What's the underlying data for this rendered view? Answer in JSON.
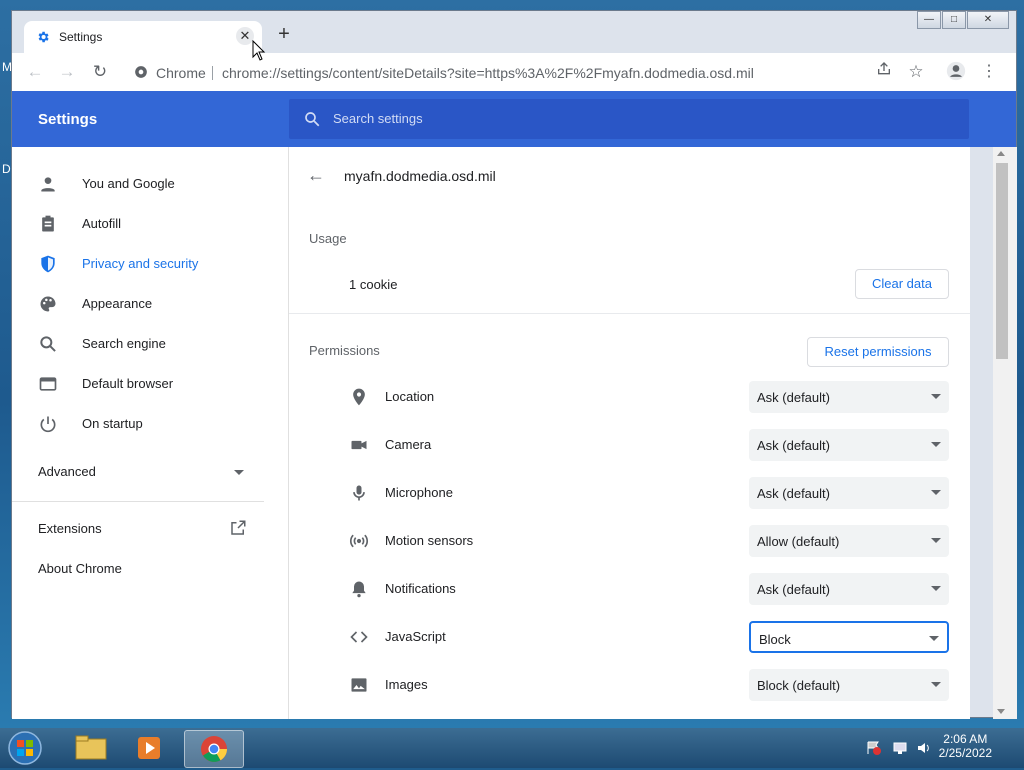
{
  "desktop": {
    "label_m": "M",
    "label_d": "D"
  },
  "tab": {
    "title": "Settings",
    "close_glyph": "✕"
  },
  "newtab_glyph": "+",
  "window_controls": {
    "minimize": "—",
    "maximize": "□",
    "close": "✕"
  },
  "omnibox": {
    "site_label": "Chrome",
    "url": "chrome://settings/content/siteDetails?site=https%3A%2F%2Fmyafn.dodmedia.osd.mil"
  },
  "header": {
    "title": "Settings",
    "search_placeholder": "Search settings"
  },
  "sidebar": {
    "items": [
      {
        "label": "You and Google",
        "icon": "person-icon"
      },
      {
        "label": "Autofill",
        "icon": "clipboard-icon"
      },
      {
        "label": "Privacy and security",
        "icon": "shield-icon",
        "active": true
      },
      {
        "label": "Appearance",
        "icon": "palette-icon"
      },
      {
        "label": "Search engine",
        "icon": "search-icon"
      },
      {
        "label": "Default browser",
        "icon": "browser-icon"
      },
      {
        "label": "On startup",
        "icon": "power-icon"
      }
    ],
    "advanced": "Advanced",
    "extensions": "Extensions",
    "about": "About Chrome"
  },
  "site": {
    "name": "myafn.dodmedia.osd.mil",
    "usage_label": "Usage",
    "cookies": "1 cookie",
    "clear_data": "Clear data",
    "permissions_label": "Permissions",
    "reset_permissions": "Reset permissions"
  },
  "permissions": [
    {
      "label": "Location",
      "value": "Ask (default)",
      "icon": "location-pin-icon"
    },
    {
      "label": "Camera",
      "value": "Ask (default)",
      "icon": "camera-icon"
    },
    {
      "label": "Microphone",
      "value": "Ask (default)",
      "icon": "microphone-icon"
    },
    {
      "label": "Motion sensors",
      "value": "Allow (default)",
      "icon": "motion-sensors-icon"
    },
    {
      "label": "Notifications",
      "value": "Ask (default)",
      "icon": "bell-icon"
    },
    {
      "label": "JavaScript",
      "value": "Block",
      "icon": "code-icon",
      "focused": true
    },
    {
      "label": "Images",
      "value": "Block (default)",
      "icon": "image-icon"
    }
  ],
  "taskbar": {
    "time": "2:06 AM",
    "date": "2/25/2022"
  },
  "colors": {
    "accent": "#3367d6",
    "link": "#1a73e8"
  }
}
